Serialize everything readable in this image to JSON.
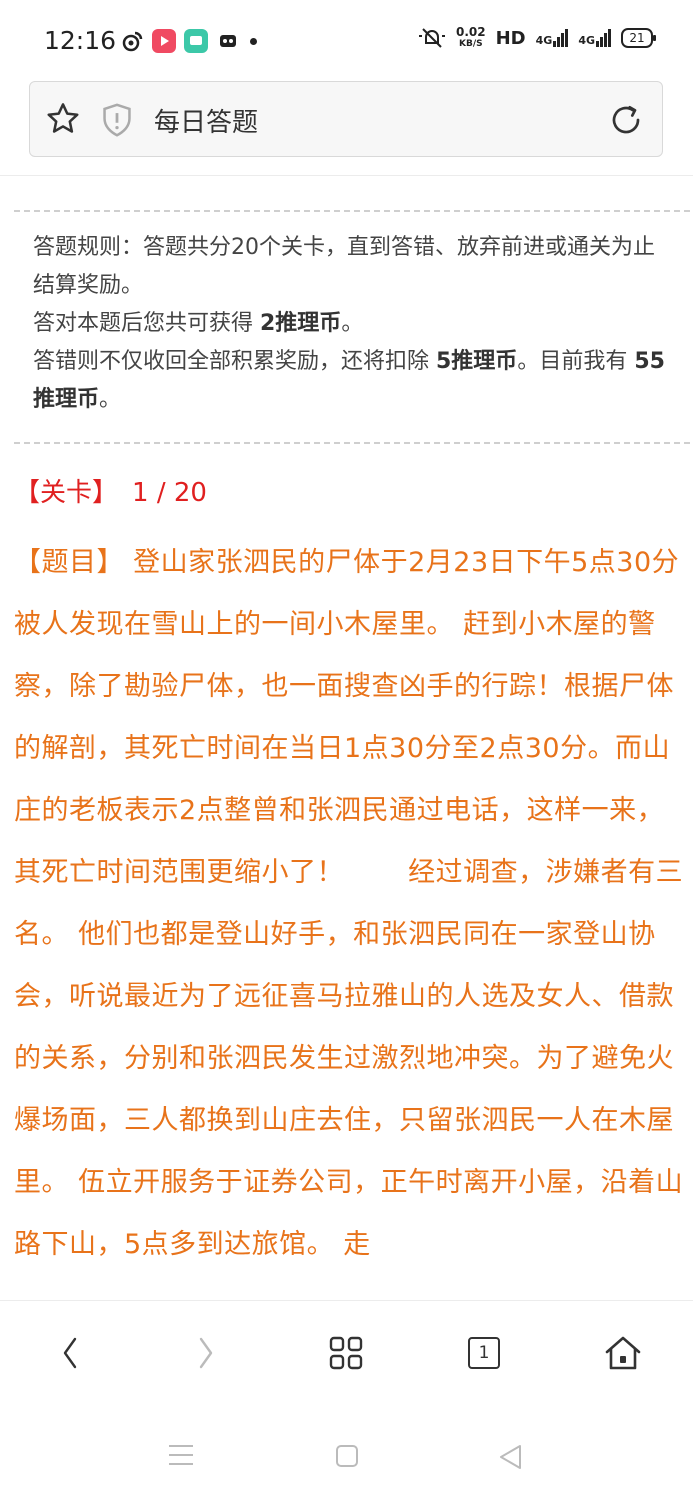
{
  "status_bar": {
    "time": "12:16",
    "net_speed_value": "0.02",
    "net_speed_unit": "KB/S",
    "hd_label": "HD",
    "signal_1": "4G",
    "signal_2": "4G",
    "battery": "21"
  },
  "address_bar": {
    "title": "每日答题"
  },
  "rules": {
    "line1": "答题规则：答题共分20个关卡，直到答错、放弃前进或通关为止结算奖励。",
    "line2_prefix": "答对本题后您共可获得 ",
    "line2_bold": "2推理币",
    "line2_suffix": "。",
    "line3_prefix": "答错则不仅收回全部积累奖励，还将扣除 ",
    "line3_bold": "5推理币",
    "line3_mid": "。目前我有 ",
    "line3_bold2": "55推理币",
    "line3_suffix": "。"
  },
  "level": {
    "label": "【关卡】",
    "value": "1 / 20"
  },
  "question": {
    "label": "【题目】",
    "text": "登山家张泗民的尸体于2月23日下午5点30分被人发现在雪山上的一间小木屋里。 赶到小木屋的警察，除了勘验尸体，也一面搜查凶手的行踪！根据尸体的解剖，其死亡时间在当日1点30分至2点30分。而山庄的老板表示2点整曾和张泗民通过电话，这样一来，其死亡时间范围更缩小了！　　 经过调查，涉嫌者有三名。 他们也都是登山好手，和张泗民同在一家登山协会，听说最近为了远征喜马拉雅山的人选及女人、借款的关系，分别和张泗民发生过激烈地冲突。为了避免火爆场面，三人都换到山庄去住，只留张泗民一人在木屋里。 伍立开服务于证券公司，正午时离开小屋，沿着山路下山，5点多到达旅馆。 走"
  },
  "toolbar": {
    "tab_count": "1"
  },
  "colors": {
    "level_red": "#e02020",
    "question_orange": "#e8731a"
  }
}
